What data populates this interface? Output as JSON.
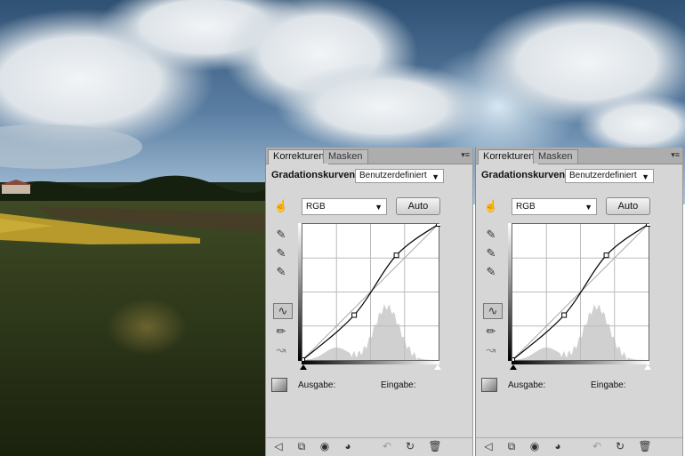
{
  "panels": [
    {
      "tabs": [
        "Korrekturen",
        "Masken"
      ],
      "menu_icon": "panel-menu-icon",
      "title": "Gradationskurven",
      "preset": "Benutzerdefiniert",
      "channel": "RGB",
      "auto_label": "Auto",
      "output_label": "Ausgabe:",
      "input_label": "Eingabe:"
    },
    {
      "tabs": [
        "Korrekturen",
        "Masken"
      ],
      "menu_icon": "panel-menu-icon",
      "title": "Gradationskurven",
      "preset": "Benutzerdefiniert",
      "channel": "RGB",
      "auto_label": "Auto",
      "output_label": "Ausgabe:",
      "input_label": "Eingabe:"
    }
  ],
  "curve_points": [
    [
      0,
      0
    ],
    [
      0.38,
      0.33
    ],
    [
      0.69,
      0.77
    ],
    [
      1,
      1
    ]
  ],
  "colors": {
    "panel_bg": "#d6d6d6",
    "tabbar_bg": "#adadad"
  }
}
